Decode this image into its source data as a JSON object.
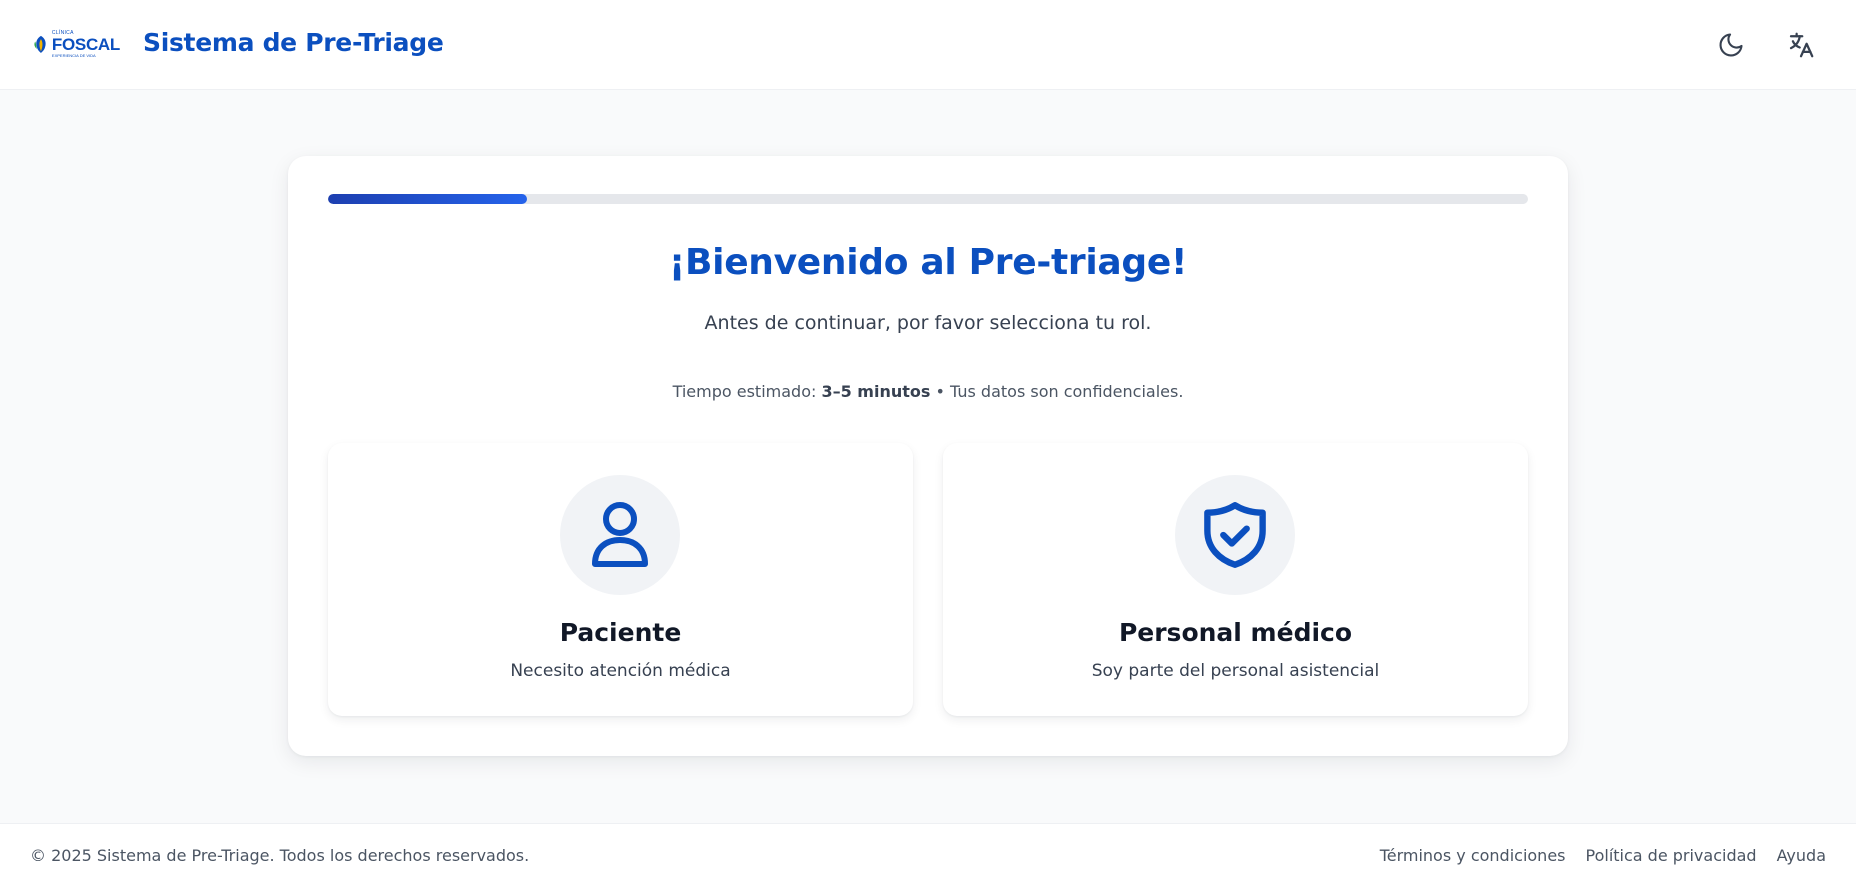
{
  "header": {
    "logo": {
      "small_text": "CLÍNICA",
      "brand": "FOSCAL",
      "sub_text": "EXPERIENCIA DE VIDA"
    },
    "title": "Sistema de Pre-Triage",
    "theme_toggle_icon": "moon-icon",
    "language_icon": "translate-icon"
  },
  "progress": {
    "fraction": 0.166
  },
  "welcome": {
    "title": "¡Bienvenido al Pre-triage!",
    "subtitle": "Antes de continuar, por favor selecciona tu rol.",
    "meta_prefix": "Tiempo estimado: ",
    "meta_time": "3–5 minutos",
    "meta_suffix": " • Tus datos son confidenciales."
  },
  "roles": [
    {
      "title": "Paciente",
      "description": "Necesito atención médica",
      "icon": "user-icon"
    },
    {
      "title": "Personal médico",
      "description": "Soy parte del personal asistencial",
      "icon": "shield-check-icon"
    }
  ],
  "footer": {
    "copyright": "© 2025 Sistema de Pre-Triage. Todos los derechos reservados.",
    "links": [
      "Términos y condiciones",
      "Política de privacidad",
      "Ayuda"
    ]
  },
  "colors": {
    "brand": "#0b4fbf",
    "progress_fill": "#2563eb",
    "progress_track": "#e5e7eb",
    "icon_circle": "#f1f3f6"
  }
}
